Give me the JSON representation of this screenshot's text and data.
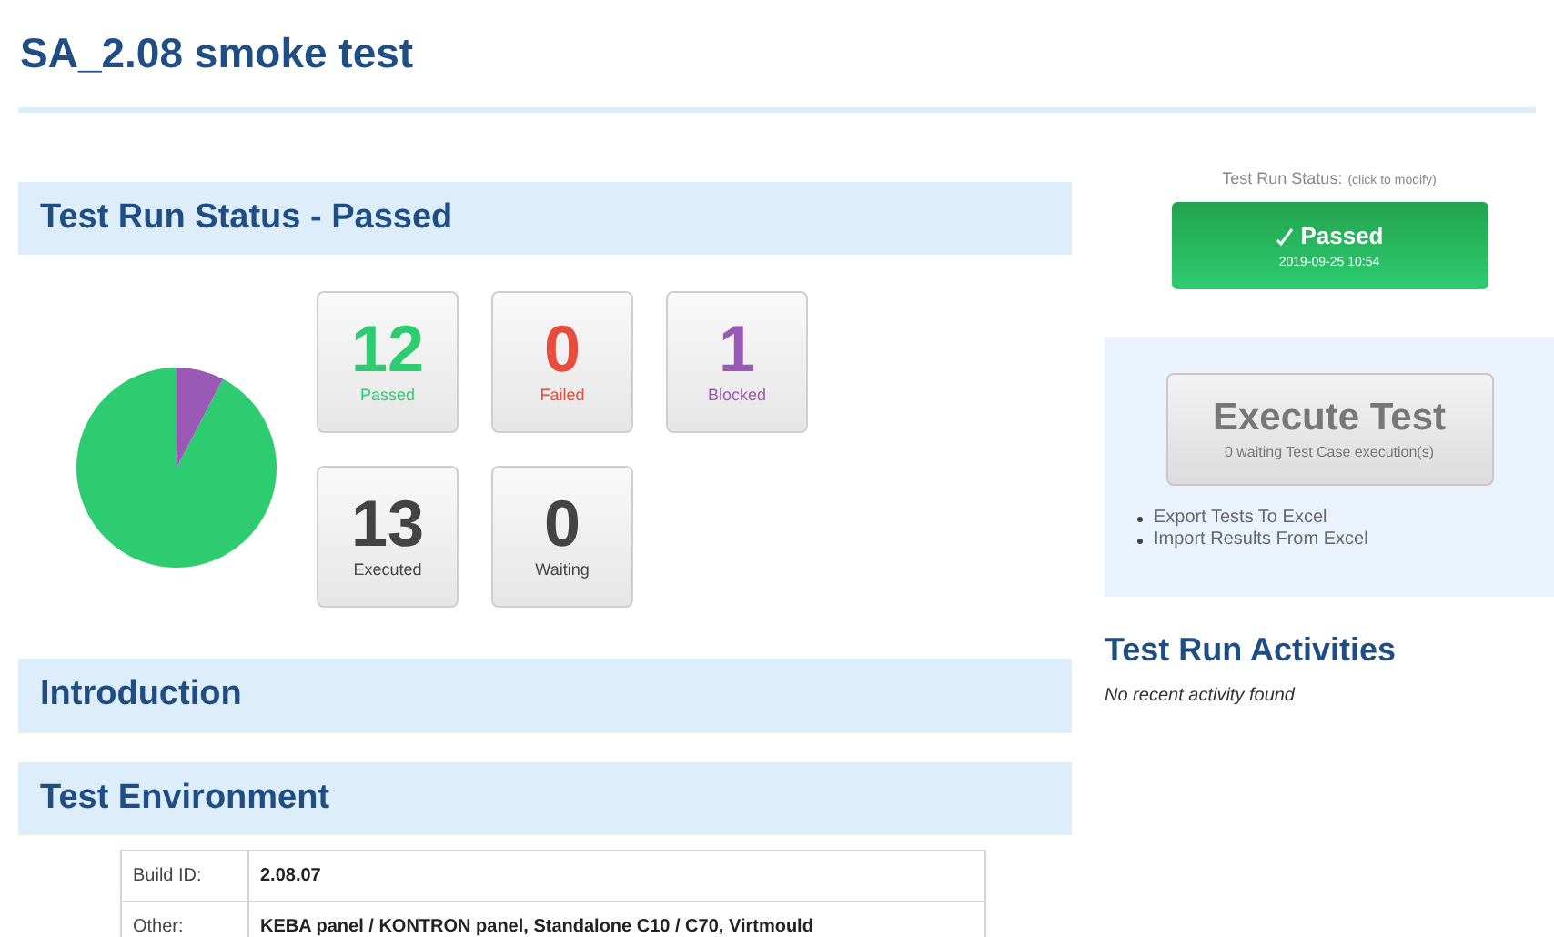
{
  "page_title": "SA_2.08 smoke test",
  "status_section": {
    "title": "Test Run Status - Passed",
    "tiles": [
      {
        "count": "12",
        "label": "Passed",
        "color": "#2ecc71",
        "kind": "result"
      },
      {
        "count": "0",
        "label": "Failed",
        "color": "#e74c3c",
        "kind": "result"
      },
      {
        "count": "1",
        "label": "Blocked",
        "color": "#9b59b6",
        "kind": "result"
      },
      {
        "count": "13",
        "label": "Executed",
        "color": "#444444",
        "kind": "total"
      },
      {
        "count": "0",
        "label": "Waiting",
        "color": "#444444",
        "kind": "total"
      }
    ]
  },
  "status_panel": {
    "label": "Test Run Status:",
    "hint": "(click to modify)",
    "button_label": "Passed",
    "button_date": "2019-09-25 10:54"
  },
  "execute_panel": {
    "button_label": "Execute Test",
    "button_sub": "0 waiting Test Case execution(s)",
    "links": [
      "Export Tests To Excel",
      "Import Results From Excel"
    ]
  },
  "activities": {
    "title": "Test Run Activities",
    "empty_text": "No recent activity found"
  },
  "introduction": {
    "title": "Introduction"
  },
  "environment": {
    "title": "Test Environment",
    "rows": [
      {
        "key": "Build ID:",
        "value": "2.08.07"
      },
      {
        "key": "Other:",
        "value": "KEBA panel / KONTRON panel, Standalone C10 / C70, Virtmould"
      }
    ]
  }
}
